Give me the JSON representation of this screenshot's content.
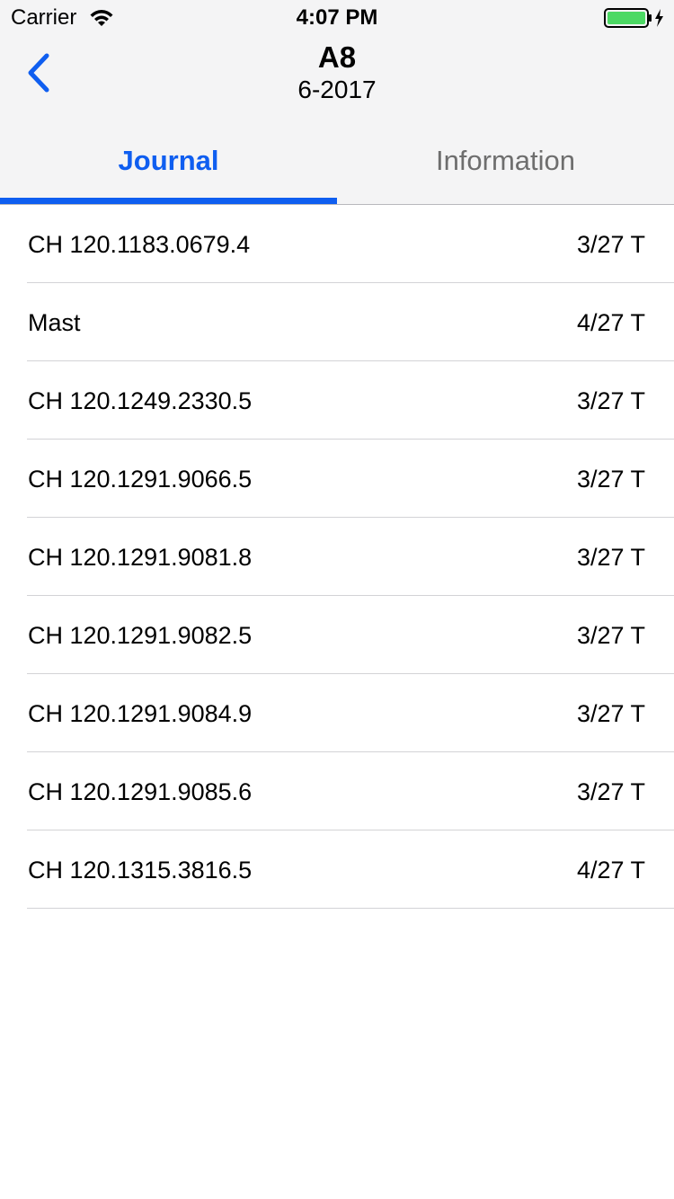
{
  "status_bar": {
    "carrier": "Carrier",
    "time": "4:07 PM"
  },
  "nav": {
    "title": "A8",
    "subtitle": "6-2017"
  },
  "tabs": [
    {
      "label": "Journal",
      "active": true
    },
    {
      "label": "Information",
      "active": false
    }
  ],
  "colors": {
    "accent": "#0f5ef0",
    "header_bg": "#f4f4f5",
    "battery": "#4cd964"
  },
  "journal": {
    "rows": [
      {
        "label": "CH 120.1183.0679.4",
        "value": "3/27 T"
      },
      {
        "label": "Mast",
        "value": "4/27 T"
      },
      {
        "label": "CH 120.1249.2330.5",
        "value": "3/27 T"
      },
      {
        "label": "CH 120.1291.9066.5",
        "value": "3/27 T"
      },
      {
        "label": "CH 120.1291.9081.8",
        "value": "3/27 T"
      },
      {
        "label": "CH 120.1291.9082.5",
        "value": "3/27 T"
      },
      {
        "label": "CH 120.1291.9084.9",
        "value": "3/27 T"
      },
      {
        "label": "CH 120.1291.9085.6",
        "value": "3/27 T"
      },
      {
        "label": "CH 120.1315.3816.5",
        "value": "4/27 T"
      }
    ]
  }
}
